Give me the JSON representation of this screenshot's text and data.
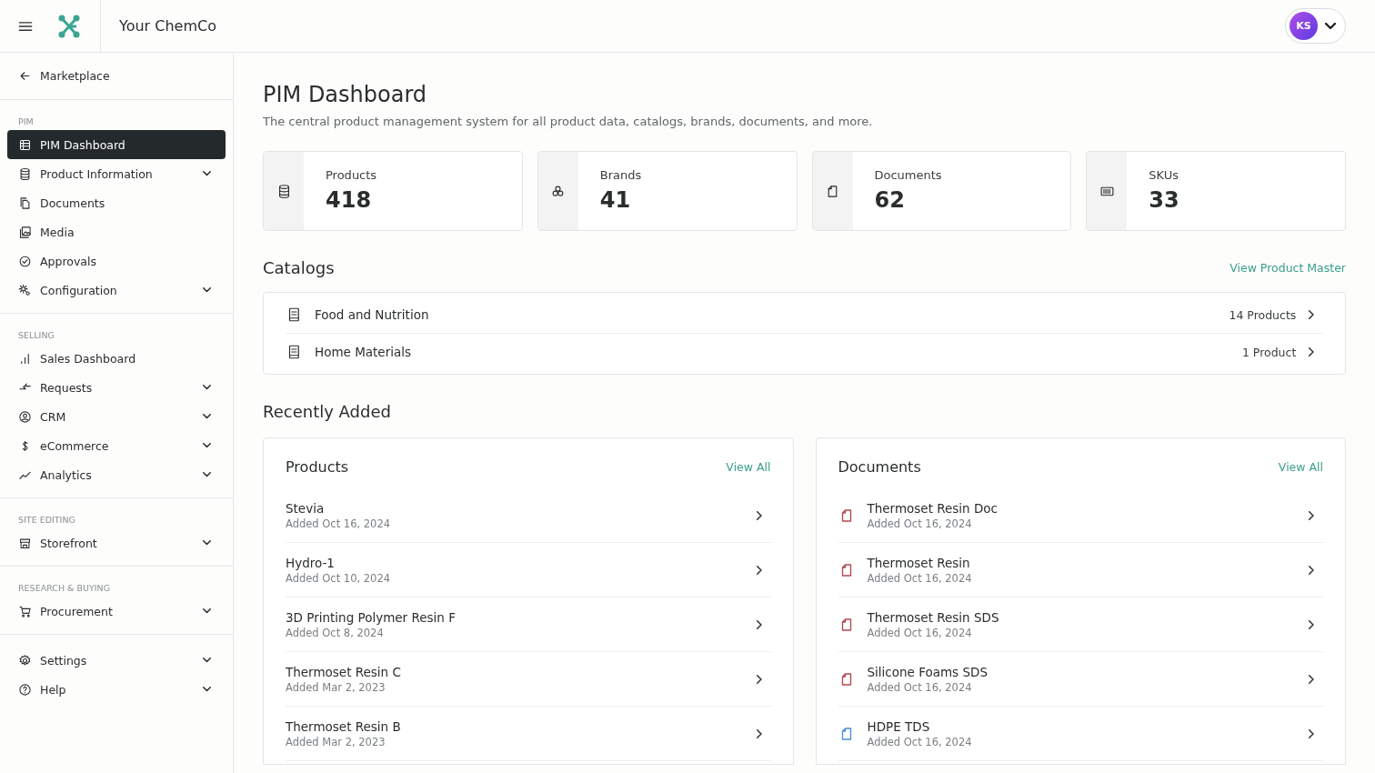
{
  "header": {
    "title": "Your ChemCo",
    "avatar": "KS"
  },
  "sidebar": {
    "back": "Marketplace",
    "sections": [
      {
        "label": "PIM",
        "items": [
          {
            "label": "PIM Dashboard",
            "selected": true,
            "expandable": false
          },
          {
            "label": "Product Information",
            "selected": false,
            "expandable": true
          },
          {
            "label": "Documents",
            "selected": false,
            "expandable": false
          },
          {
            "label": "Media",
            "selected": false,
            "expandable": false
          },
          {
            "label": "Approvals",
            "selected": false,
            "expandable": false
          },
          {
            "label": "Configuration",
            "selected": false,
            "expandable": true
          }
        ]
      },
      {
        "label": "SELLING",
        "items": [
          {
            "label": "Sales Dashboard",
            "selected": false,
            "expandable": false
          },
          {
            "label": "Requests",
            "selected": false,
            "expandable": true
          },
          {
            "label": "CRM",
            "selected": false,
            "expandable": true
          },
          {
            "label": "eCommerce",
            "selected": false,
            "expandable": true
          },
          {
            "label": "Analytics",
            "selected": false,
            "expandable": true
          }
        ]
      },
      {
        "label": "SITE EDITING",
        "items": [
          {
            "label": "Storefront",
            "selected": false,
            "expandable": true
          }
        ]
      },
      {
        "label": "RESEARCH & BUYING",
        "items": [
          {
            "label": "Procurement",
            "selected": false,
            "expandable": true
          }
        ]
      },
      {
        "items": [
          {
            "label": "Settings",
            "selected": false,
            "expandable": true
          },
          {
            "label": "Help",
            "selected": false,
            "expandable": true
          }
        ]
      }
    ]
  },
  "page": {
    "title": "PIM Dashboard",
    "subtitle": "The central product management system for all product data, catalogs, brands, documents, and more."
  },
  "stats": [
    {
      "label": "Products",
      "value": "418"
    },
    {
      "label": "Brands",
      "value": "41"
    },
    {
      "label": "Documents",
      "value": "62"
    },
    {
      "label": "SKUs",
      "value": "33"
    }
  ],
  "catalogs": {
    "title": "Catalogs",
    "link": "View Product Master",
    "items": [
      {
        "name": "Food and Nutrition",
        "count": "14 Products"
      },
      {
        "name": "Home Materials",
        "count": "1 Product"
      }
    ]
  },
  "recent": {
    "title": "Recently Added",
    "panels": [
      {
        "kind": "products",
        "title": "Products",
        "link": "View All",
        "items": [
          {
            "name": "Stevia",
            "date": "Added Oct 16, 2024"
          },
          {
            "name": "Hydro-1",
            "date": "Added Oct 10, 2024"
          },
          {
            "name": "3D Printing Polymer Resin F",
            "date": "Added Oct 8, 2024"
          },
          {
            "name": "Thermoset Resin C",
            "date": "Added Mar 2, 2023"
          },
          {
            "name": "Thermoset Resin B",
            "date": "Added Mar 2, 2023"
          }
        ]
      },
      {
        "kind": "documents",
        "title": "Documents",
        "link": "View All",
        "items": [
          {
            "name": "Thermoset Resin Doc",
            "date": "Added Oct 16, 2024",
            "color": "#b5474f"
          },
          {
            "name": "Thermoset Resin",
            "date": "Added Oct 16, 2024",
            "color": "#b5474f"
          },
          {
            "name": "Thermoset Resin SDS",
            "date": "Added Oct 16, 2024",
            "color": "#b5474f"
          },
          {
            "name": "Silicone Foams SDS",
            "date": "Added Oct 16, 2024",
            "color": "#b5474f"
          },
          {
            "name": "HDPE TDS",
            "date": "Added Oct 16, 2024",
            "color": "#4a8fd8"
          }
        ]
      }
    ]
  }
}
